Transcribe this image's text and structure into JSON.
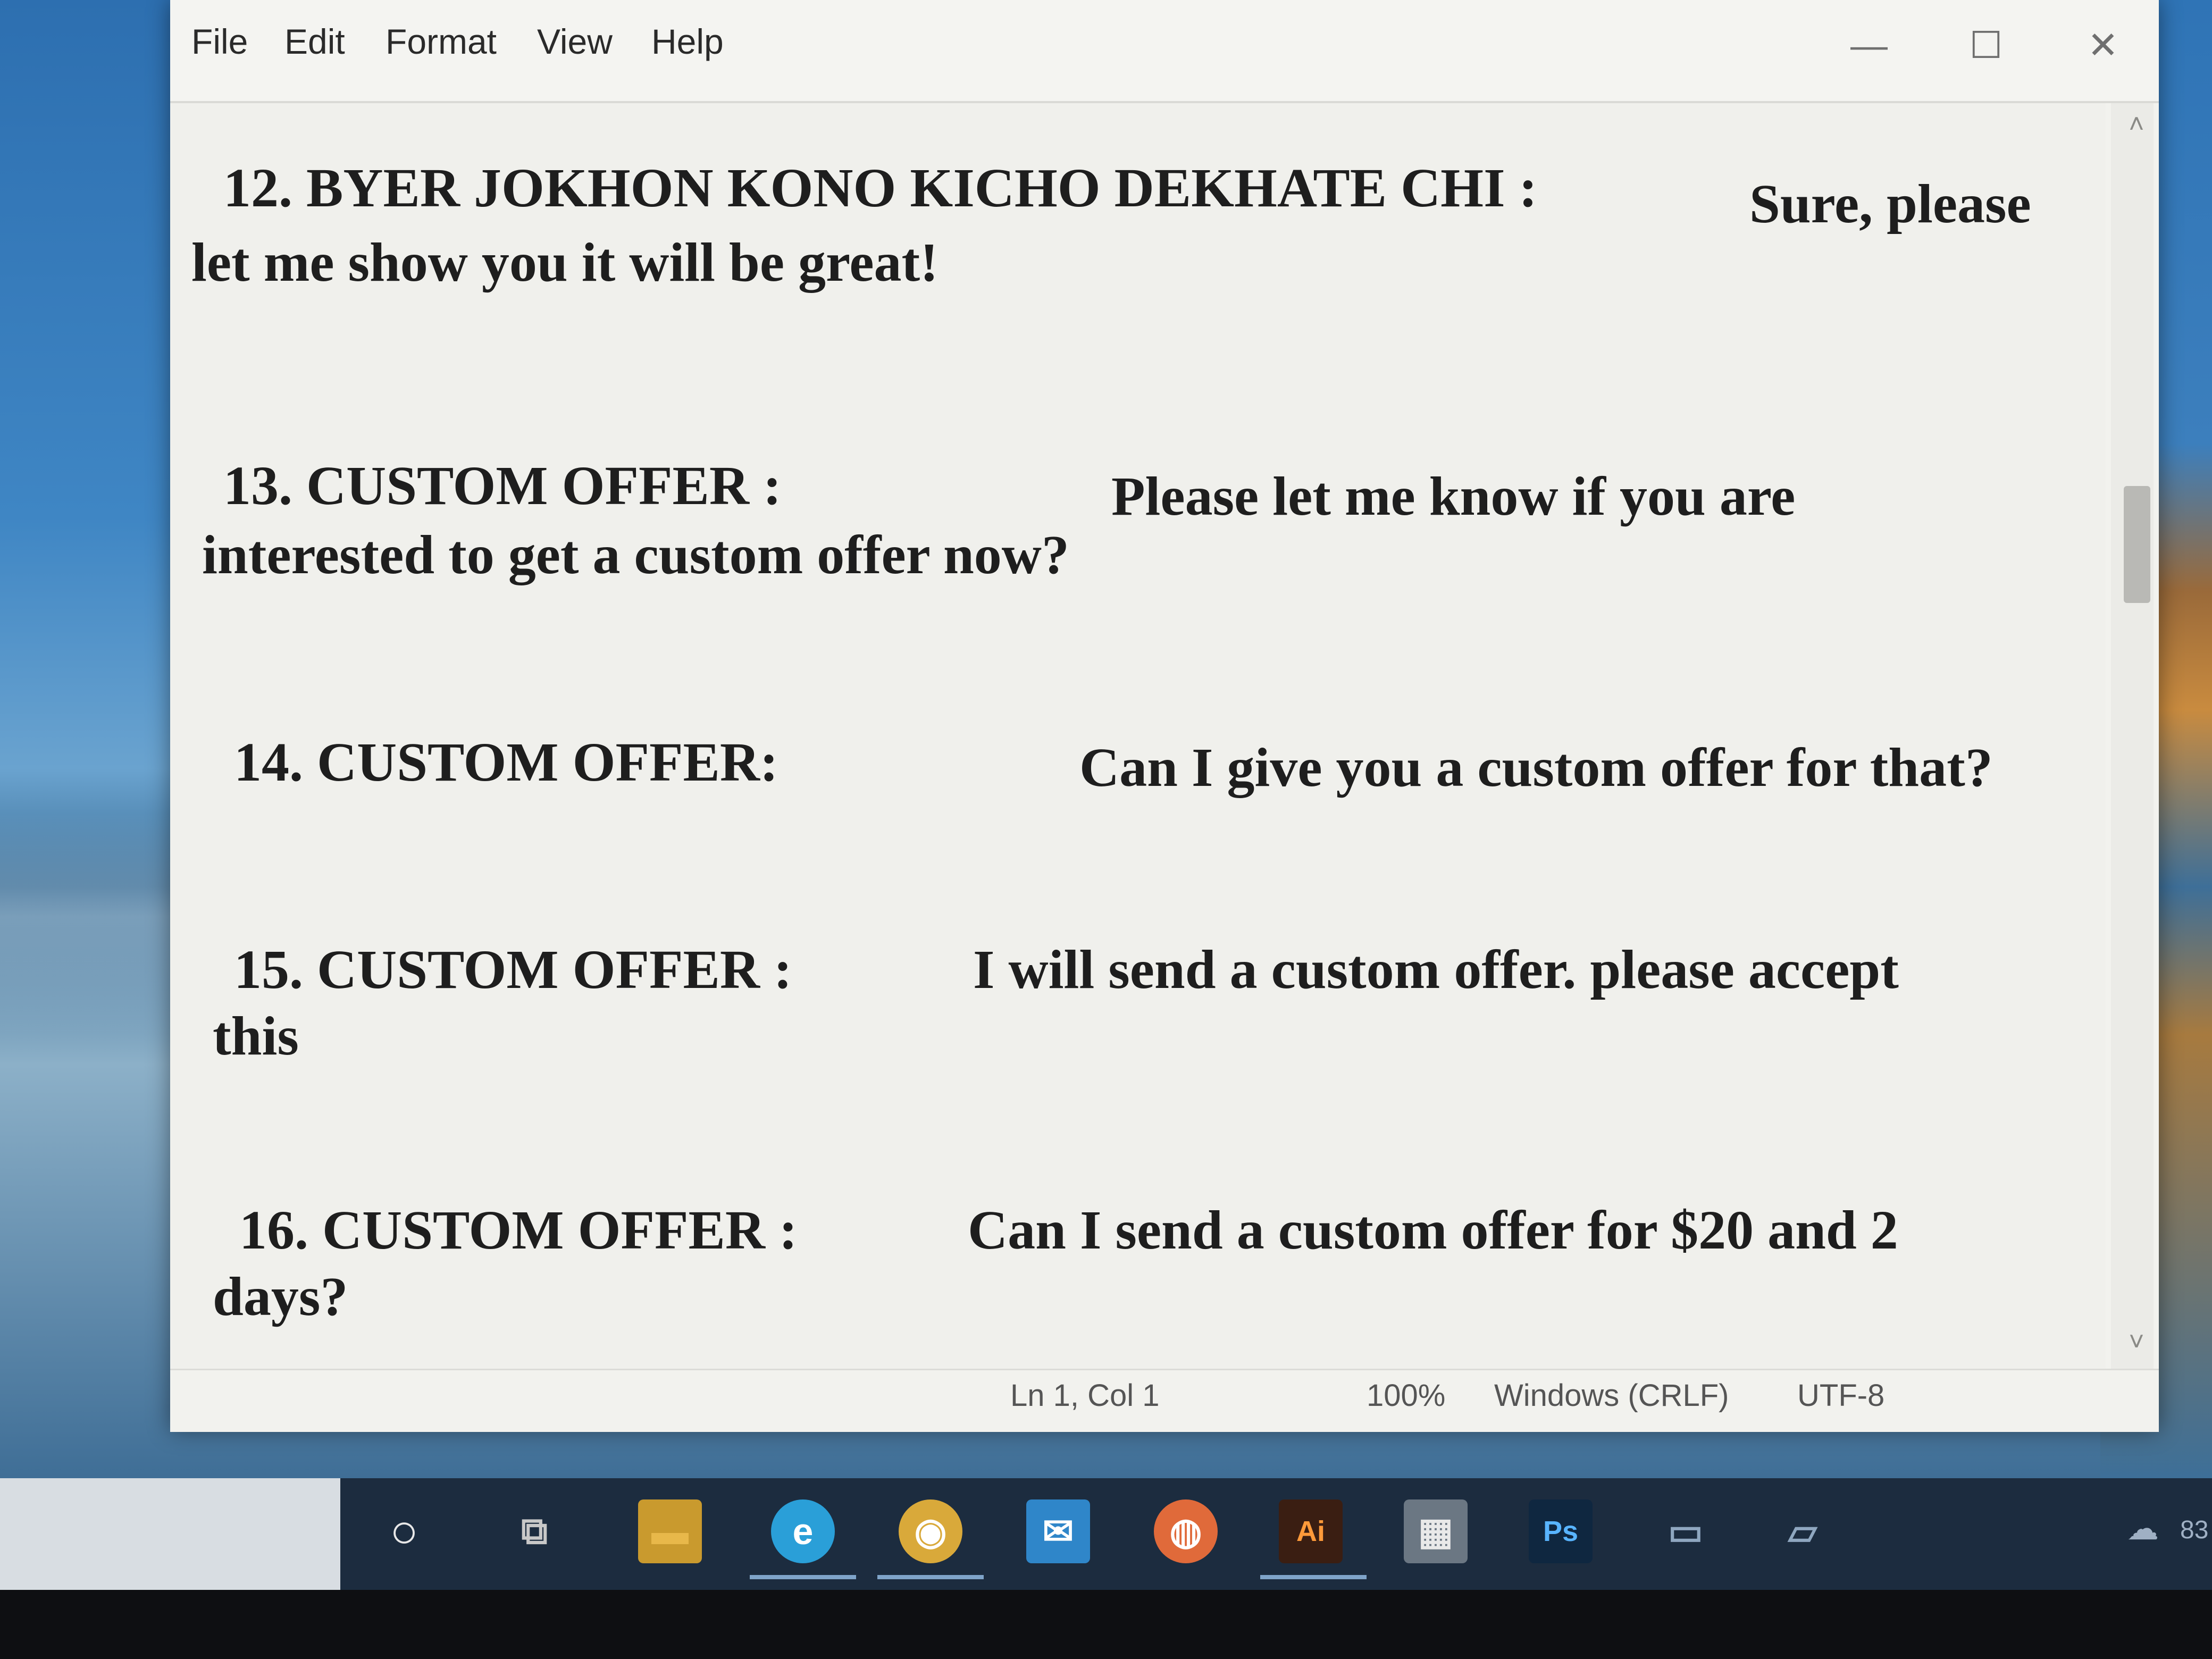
{
  "menu": {
    "file": "File",
    "edit": "Edit",
    "format": "Format",
    "view": "View",
    "help": "Help"
  },
  "window_controls": {
    "minimize": "—",
    "maximize": "☐",
    "close": "✕"
  },
  "entries": [
    {
      "title": "12.  BYER JOKHON KONO KICHO DEKHATE CHI :",
      "reply": "Sure, please",
      "continuation": "let me show you it will be great!"
    },
    {
      "title": "13.  CUSTOM OFFER :",
      "reply": "Please let me know if you are",
      "continuation": "interested to get a custom offer now?"
    },
    {
      "title": "14.  CUSTOM OFFER:",
      "reply": "Can I give you a custom offer for that?",
      "continuation": ""
    },
    {
      "title": "15.  CUSTOM OFFER :",
      "reply": "I will send a custom offer. please accept",
      "continuation": "this"
    },
    {
      "title": "16.  CUSTOM OFFER :",
      "reply": "Can I send a custom offer for $20  and 2",
      "continuation": "days?"
    }
  ],
  "status": {
    "position": "Ln 1, Col 1",
    "zoom": "100%",
    "line_endings": "Windows (CRLF)",
    "encoding": "UTF-8"
  },
  "taskbar": {
    "icons": [
      {
        "name": "search-circle-icon",
        "glyph": "○"
      },
      {
        "name": "task-view-icon",
        "glyph": "⧉"
      },
      {
        "name": "file-explorer-icon",
        "glyph": "▬"
      },
      {
        "name": "edge-icon",
        "glyph": "e"
      },
      {
        "name": "chrome-icon",
        "glyph": "◉"
      },
      {
        "name": "mail-icon",
        "glyph": "✉"
      },
      {
        "name": "firefox-icon",
        "glyph": "◍"
      },
      {
        "name": "illustrator-icon",
        "glyph": "Ai"
      },
      {
        "name": "store-icon",
        "glyph": "▦"
      },
      {
        "name": "photoshop-icon",
        "glyph": "Ps"
      },
      {
        "name": "app-icon-1",
        "glyph": "▭"
      },
      {
        "name": "app-icon-2",
        "glyph": "▱"
      }
    ],
    "tray_text": "83"
  },
  "colors": {
    "text": "#1e1e1e",
    "editor_bg": "#f0f0ec",
    "taskbar_bg": "#1c2c3f"
  }
}
